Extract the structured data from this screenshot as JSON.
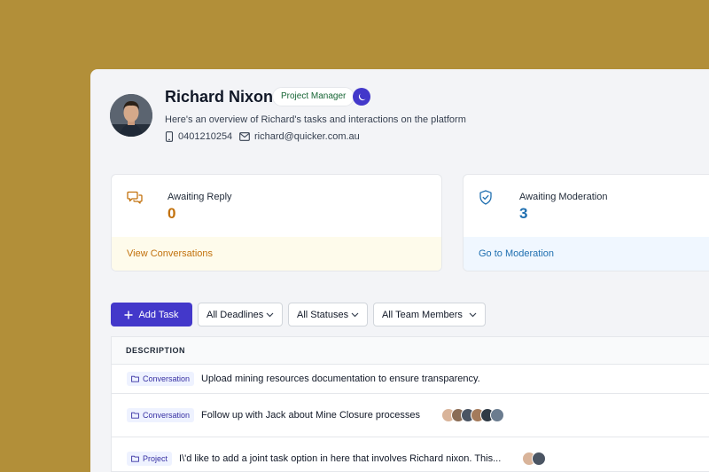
{
  "profile": {
    "name": "Richard Nixon",
    "role": "Project Manager",
    "overview": "Here's an overview of Richard's tasks and interactions on the platform",
    "phone": "0401210254",
    "email": "richard@quicker.com.au"
  },
  "cards": [
    {
      "label": "Awaiting Reply",
      "count": "0",
      "link": "View Conversations",
      "accent": "#c2710c",
      "footer_bg": "#fefbeb",
      "icon": "chat-bubbles-icon"
    },
    {
      "label": "Awaiting Moderation",
      "count": "3",
      "link": "Go to Moderation",
      "accent": "#1f6fb0",
      "footer_bg": "#f0f7ff",
      "icon": "shield-check-icon"
    }
  ],
  "toolbar": {
    "add_label": "Add Task",
    "filters": [
      "All Deadlines",
      "All Statuses",
      "All Team Members"
    ]
  },
  "table": {
    "header": "DESCRIPTION",
    "rows": [
      {
        "tag": "Conversation",
        "text": "Upload mining resources documentation to ensure transparency.",
        "avatars": 0
      },
      {
        "tag": "Conversation",
        "text": "Follow up with Jack about Mine Closure processes",
        "avatars": 6
      },
      {
        "tag": "Project",
        "text": "I\\'d like to add a joint task option in here that involves Richard nixon. This...",
        "avatars": 2
      }
    ]
  },
  "colors": {
    "background": "#b28f39",
    "primary": "#4338ca",
    "role_text": "#166534"
  }
}
